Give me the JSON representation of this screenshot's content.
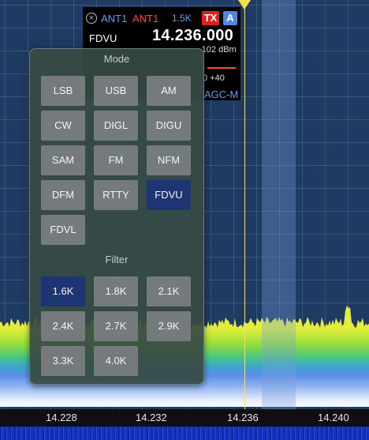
{
  "slice": {
    "close_glyph": "×",
    "antenna_rx": "ANT1",
    "antenna_tx": "ANT1",
    "filter_width": "1.5K",
    "tx_badge": "TX",
    "slice_letter": "A",
    "mode": "FDVU",
    "frequency": "14.236.000",
    "signal_level": "-102 dBm",
    "meter_scale": "0 +40",
    "agc": "AGC-M"
  },
  "mode_popup": {
    "mode_title": "Mode",
    "modes": [
      "LSB",
      "USB",
      "AM",
      "CW",
      "DIGL",
      "DIGU",
      "SAM",
      "FM",
      "NFM",
      "DFM",
      "RTTY",
      "FDVU",
      "FDVL"
    ],
    "selected_mode": "FDVU",
    "filter_title": "Filter",
    "filters": [
      "1.6K",
      "1.8K",
      "2.1K",
      "2.4K",
      "2.7K",
      "2.9K",
      "3.3K",
      "4.0K"
    ],
    "selected_filter": "1.6K"
  },
  "frequency_axis": {
    "ticks": [
      "14.228",
      "14.232",
      "14.236",
      "14.240"
    ]
  },
  "colors": {
    "selected_button": "#1d3673",
    "button": "#757a7d",
    "tx": "#e02020",
    "antenna_blue": "#5aa0f0",
    "antenna_red": "#ff4a3a"
  }
}
